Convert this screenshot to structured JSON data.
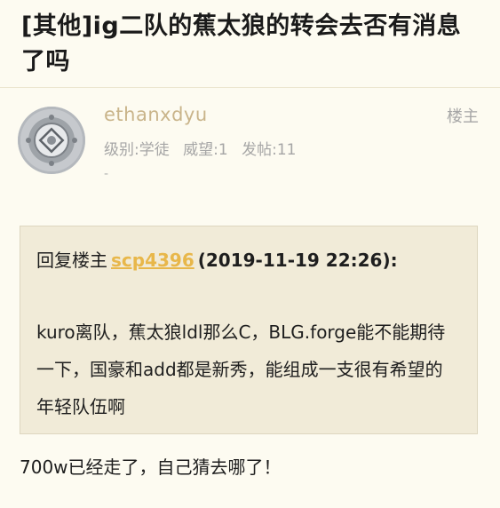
{
  "thread": {
    "title": "[其他]ig二队的蕉太狼的转会去否有消息了吗"
  },
  "post": {
    "author": {
      "username": "ethanxdyu",
      "avatar_icon": "diving-helmet-icon",
      "level_label": "级别:",
      "level_value": "学徒",
      "prestige_label": "威望:",
      "prestige_value": "1",
      "posts_label": "发帖:",
      "posts_value": "11",
      "signature": "-"
    },
    "op_badge": "楼主",
    "quote": {
      "prefix": "回复楼主",
      "quoted_user": "scp4396",
      "timestamp": "(2019-11-19 22:26):",
      "body": "kuro离队，蕉太狼ldl那么C，BLG.forge能不能期待一下，国豪和add都是新秀，能组成一支很有希望的年轻队伍啊"
    },
    "reply": "700w已经走了，自己猜去哪了！"
  },
  "colors": {
    "background": "#fdfbf1",
    "username": "#c9b48a",
    "quote_background": "#f1ebd8",
    "quote_link": "#e8b74a",
    "meta_gray": "#a6a6a6"
  }
}
